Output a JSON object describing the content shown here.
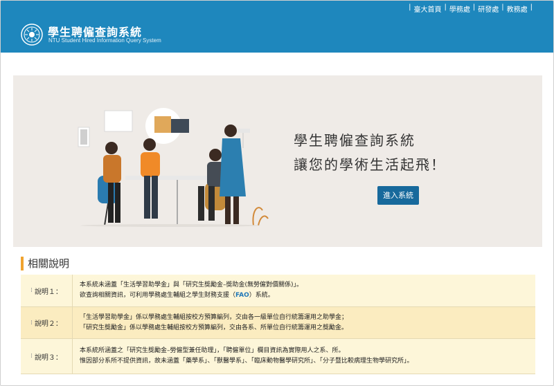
{
  "header": {
    "title": "學生聘僱查詢系統",
    "subtitle": "NTU Student Hired Information Query System",
    "links": [
      "臺大首頁",
      "學務處",
      "研發處",
      "教務處"
    ]
  },
  "hero": {
    "line1": "學生聘僱查詢系統",
    "line2": "讓您的學術生活起飛！",
    "button_label": "進入系統"
  },
  "section": {
    "title": "相關說明",
    "rows": [
      {
        "label": "說明１：",
        "line1": "本系統未涵蓋「生活學習助學金」與「研究生獎勵金–獎助金(無勞僱對價關係)」。",
        "line2_pre": "欲查詢相關資訊，可利用學務處生輔組之學生財務支援（",
        "line2_link": "FAO",
        "line2_post": "）系統。"
      },
      {
        "label": "說明２：",
        "line1": "「生活學習助學金」係以學務處生輔組按校方預算編列，交由各一級單位自行統籌運用之助學金；",
        "line2": "「研究生獎勵金」係以學務處生輔組按校方預算編列，交由各系、所單位自行統籌運用之獎勵金。"
      },
      {
        "label": "說明３：",
        "line1": "本系統所涵蓋之「研究生獎勵金–勞僱型兼任助理」，「聘僱單位」欄目資訊為實際用人之系、所。",
        "line2": "惟因部分系所不提供資訊，故未涵蓋「藥學系」、「獸醫學系」、「臨床動物醫學研究所」、「分子暨比較病理生物學研究所」。"
      }
    ]
  },
  "colors": {
    "header_bg": "#1e87bd",
    "hero_bg": "#efebe7",
    "button_bg": "#17699c",
    "accent": "#f0a32f",
    "row_light": "#fdf6d9",
    "row_dark": "#fbecc0"
  }
}
